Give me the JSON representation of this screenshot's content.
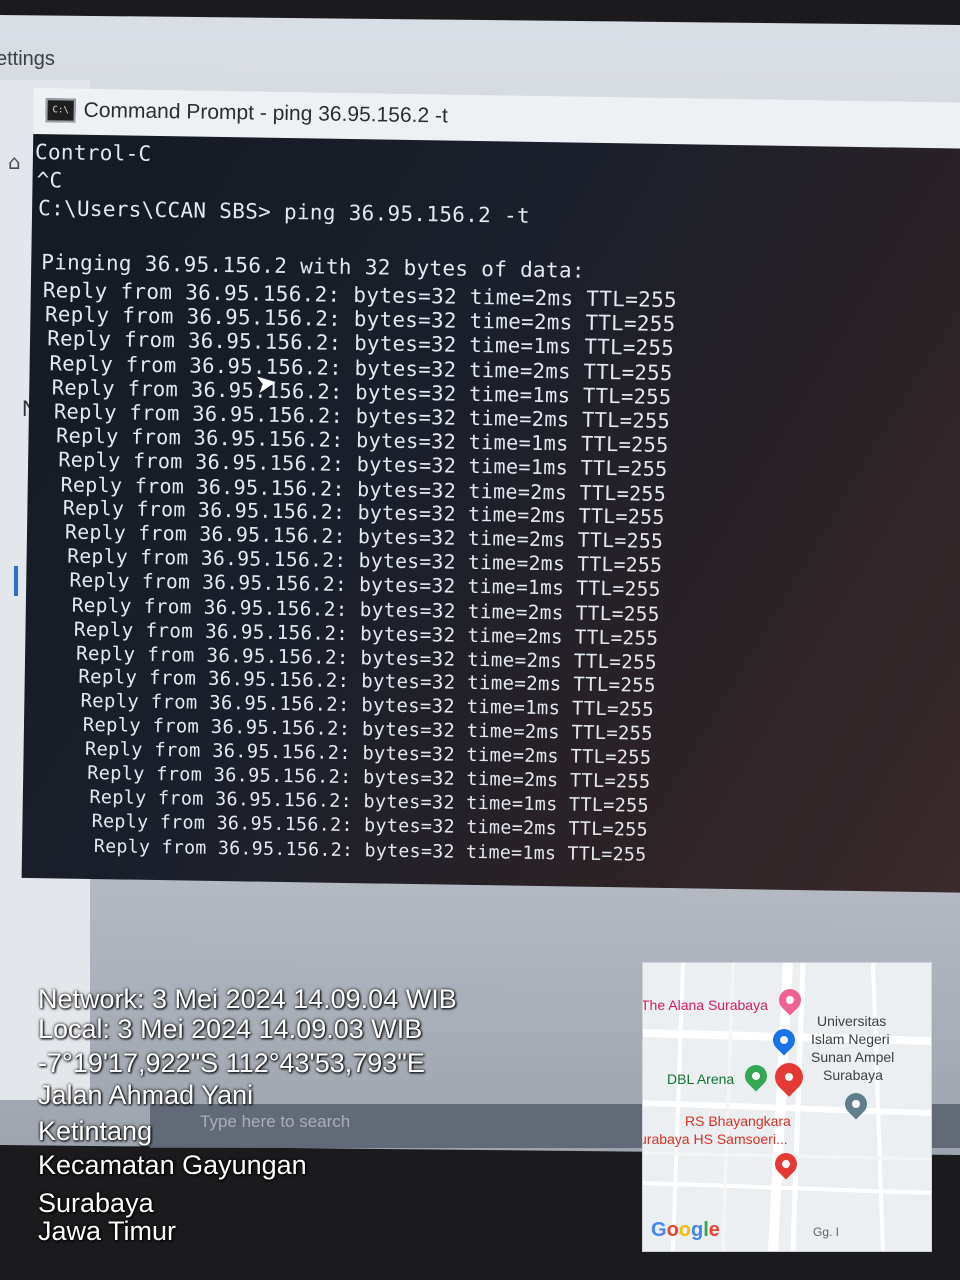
{
  "settings": {
    "title": "ettings",
    "side_partial": "Ne",
    "icons": [
      "home-icon",
      "globe-icon",
      "monitor-icon",
      "dialup-icon",
      "vpn-icon",
      "airplane-icon",
      "hotspot-icon",
      "proxy-icon"
    ]
  },
  "cmd": {
    "title": "Command Prompt - ping  36.95.156.2 -t",
    "icon_text": "C:\\",
    "lines": {
      "l0": "Control-C",
      "l1": "^C",
      "l2": "C:\\Users\\CCAN SBS> ping 36.95.156.2 -t",
      "l3": "Pinging 36.95.156.2 with 32 bytes of data:"
    },
    "replies": [
      "Reply from 36.95.156.2: bytes=32 time=2ms TTL=255",
      "Reply from 36.95.156.2: bytes=32 time=2ms TTL=255",
      "Reply from 36.95.156.2: bytes=32 time=1ms TTL=255",
      "Reply from 36.95.156.2: bytes=32 time=2ms TTL=255",
      "Reply from 36.95.156.2: bytes=32 time=1ms TTL=255",
      "Reply from 36.95.156.2: bytes=32 time=2ms TTL=255",
      "Reply from 36.95.156.2: bytes=32 time=1ms TTL=255",
      "Reply from 36.95.156.2: bytes=32 time=1ms TTL=255",
      "Reply from 36.95.156.2: bytes=32 time=2ms TTL=255",
      "Reply from 36.95.156.2: bytes=32 time=2ms TTL=255",
      "Reply from 36.95.156.2: bytes=32 time=2ms TTL=255",
      "Reply from 36.95.156.2: bytes=32 time=2ms TTL=255",
      "Reply from 36.95.156.2: bytes=32 time=1ms TTL=255",
      "Reply from 36.95.156.2: bytes=32 time=2ms TTL=255",
      "Reply from 36.95.156.2: bytes=32 time=2ms TTL=255",
      "Reply from 36.95.156.2: bytes=32 time=2ms TTL=255",
      "Reply from 36.95.156.2: bytes=32 time=2ms TTL=255",
      "Reply from 36.95.156.2: bytes=32 time=1ms TTL=255",
      "Reply from 36.95.156.2: bytes=32 time=2ms TTL=255",
      "Reply from 36.95.156.2: bytes=32 time=2ms TTL=255",
      "Reply from 36.95.156.2: bytes=32 time=2ms TTL=255",
      "Reply from 36.95.156.2: bytes=32 time=1ms TTL=255",
      "Reply from 36.95.156.2: bytes=32 time=2ms TTL=255",
      "Reply from 36.95.156.2: bytes=32 time=1ms TTL=255"
    ]
  },
  "taskbar": {
    "search_placeholder": "Type here to search"
  },
  "geo_overlay": {
    "network": "Network: 3 Mei 2024 14.09.04 WIB",
    "local": "Local: 3 Mei 2024 14.09.03 WIB",
    "coordinates": "-7°19'17,922\"S 112°43'53,793\"E",
    "street": "Jalan Ahmad Yani",
    "village": "Ketintang",
    "district": "Kecamatan Gayungan",
    "city": "Surabaya",
    "province": "Jawa Timur"
  },
  "map": {
    "labels": {
      "hotel": "The Alana Surabaya",
      "univ1": "Universitas",
      "univ2": "Islam Negeri",
      "univ3": "Sunan Ampel",
      "univ4": "Surabaya",
      "arena": "DBL Arena",
      "hospital1": "RS Bhayangkara",
      "hospital2": "urabaya HS Samsoeri...",
      "road": "Gg. I"
    },
    "logo": "Google",
    "colors": {
      "pin": "#e53935",
      "arena_pin": "#34a853",
      "edu_pin": "#1a73e8",
      "hotel_pin": "#f06292",
      "place_pin": "#607d8b"
    }
  }
}
